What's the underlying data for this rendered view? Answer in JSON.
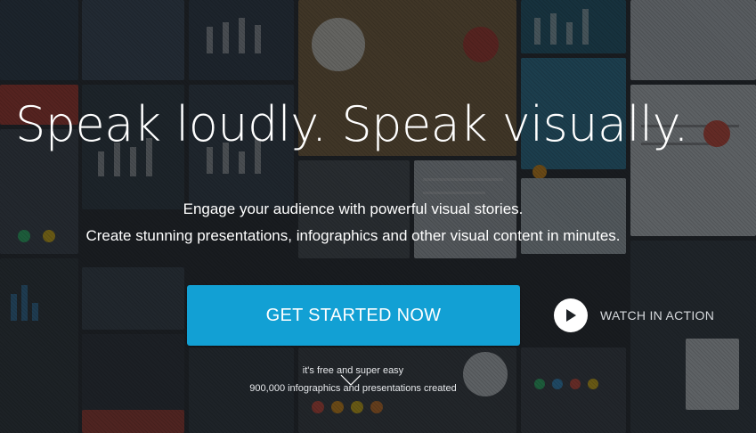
{
  "hero": {
    "headline": "Speak loudly. Speak visually.",
    "subtitle_line1": "Engage your audience with powerful visual stories.",
    "subtitle_line2": "Create stunning presentations, infographics and other visual content in minutes.",
    "cta_label": "GET STARTED NOW",
    "watch_label": "WATCH IN ACTION",
    "free_note": "it's free and super easy",
    "count_note": "900,000 infographics and presentations created"
  },
  "icons": {
    "play": "play-icon",
    "chevron": "chevron-down-icon"
  },
  "colors": {
    "cta_background": "#12a0d4",
    "overlay": "#14161a",
    "text": "#ffffff"
  }
}
